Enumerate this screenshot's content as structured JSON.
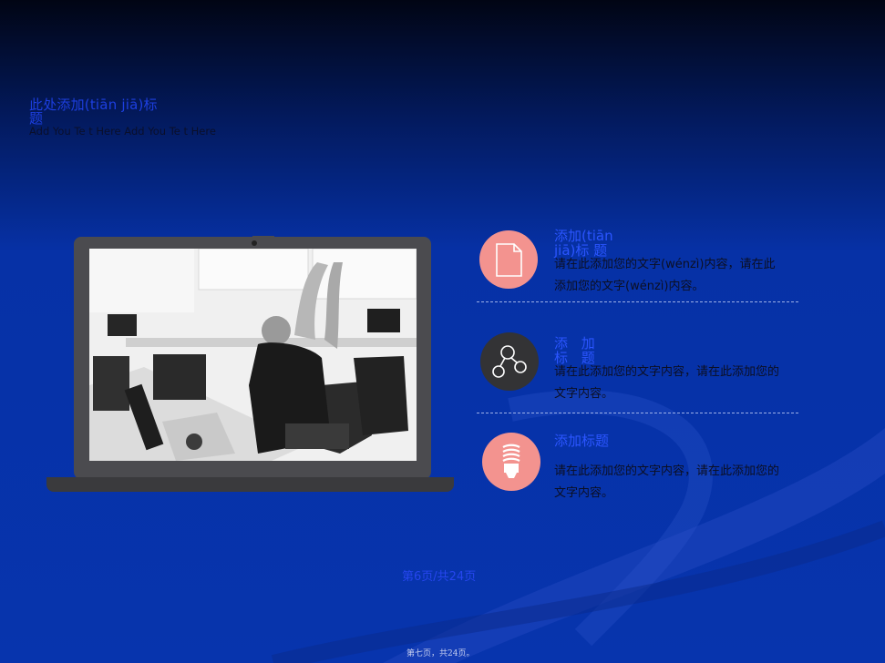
{
  "slide": {
    "title": "此处添加(tiān jiā)标　　　题",
    "subtitle": "Add You Te t Here Add You Te t Here"
  },
  "items": [
    {
      "title": "添加(tiān jiā)标 题",
      "text": "请在此添加您的文字(wénzì)内容，请在此添加您的文字(wénzì)内容。",
      "icon": "document-icon",
      "icon_color": "#f3938f"
    },
    {
      "title": "添 加 标 题",
      "text": "请在此添加您的文字内容，请在此添加您的文字内容。",
      "icon": "network-icon",
      "icon_color": "#333335"
    },
    {
      "title": "添加标题",
      "text": "请在此添加您的文字内容，请在此添加您的文字内容。",
      "icon": "lightbulb-icon",
      "icon_color": "#f3938f"
    }
  ],
  "page_indicator": "第6页/共24页",
  "footer": "第七页，共24页。"
}
